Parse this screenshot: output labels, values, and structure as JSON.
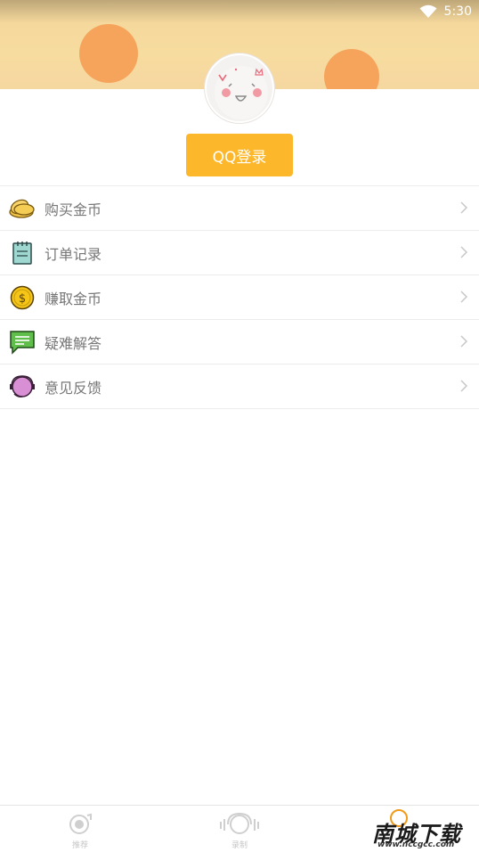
{
  "status_bar": {
    "time": "5:30",
    "wifi_icon": "wifi-icon"
  },
  "login": {
    "button_label": "QQ登录",
    "avatar_icon": "default-avatar-face"
  },
  "menu": {
    "items": [
      {
        "label": "购买金币",
        "icon": "coins-icon"
      },
      {
        "label": "订单记录",
        "icon": "notepad-icon"
      },
      {
        "label": "赚取金币",
        "icon": "dollar-coin-icon"
      },
      {
        "label": "疑难解答",
        "icon": "chat-bubble-icon"
      },
      {
        "label": "意见反馈",
        "icon": "headset-icon"
      }
    ]
  },
  "tabbar": {
    "tabs": [
      {
        "label": "推荐",
        "icon": "disc-icon"
      },
      {
        "label": "录制",
        "icon": "headphone-icon"
      }
    ]
  },
  "watermark": {
    "text": "南城下载",
    "url": "www.nccgcc.com"
  },
  "colors": {
    "accent": "#fdb72a",
    "banner": "#f7dc9f",
    "banner_dot": "#f6a45c",
    "divider": "#ececec"
  }
}
